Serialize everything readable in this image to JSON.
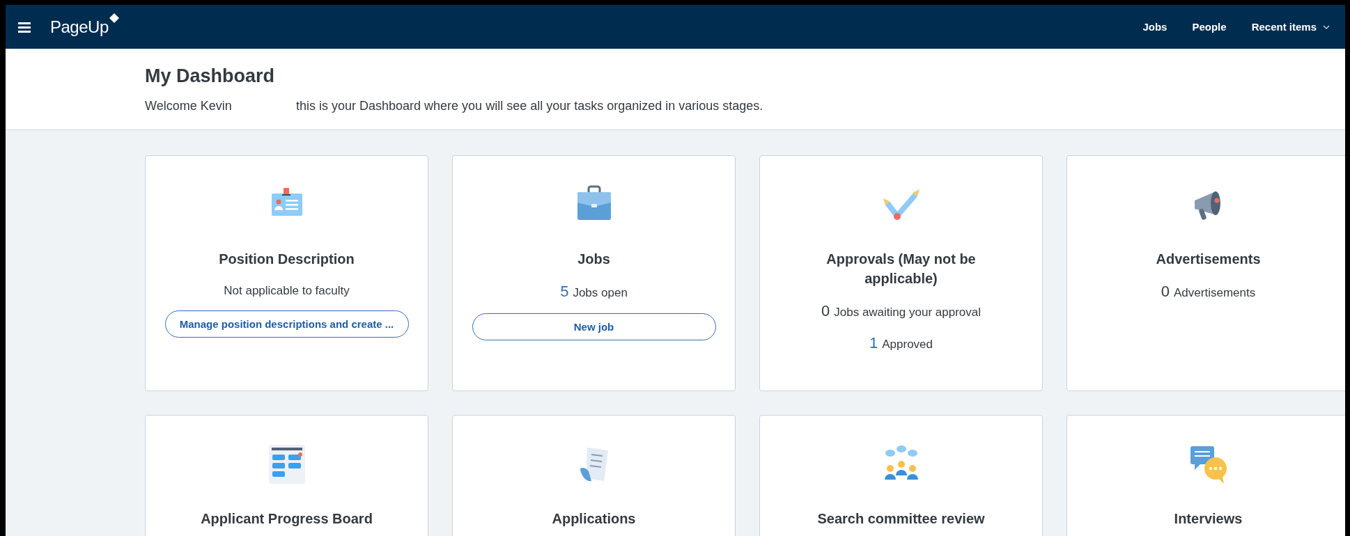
{
  "header": {
    "logo": "PageUp",
    "nav": [
      "Jobs",
      "People",
      "Recent items"
    ]
  },
  "page": {
    "title": "My Dashboard",
    "welcome": "Welcome Kevin",
    "subtitle": "this is your Dashboard where you will see all your tasks organized in various stages."
  },
  "cards": [
    {
      "title": "Position Description",
      "note": "Not applicable to faculty",
      "button": "Manage position descriptions and create ..."
    },
    {
      "title": "Jobs",
      "stats": [
        {
          "count": "5",
          "text": "Jobs open",
          "color": "#2f6fb5"
        }
      ],
      "button": "New job"
    },
    {
      "title": "Approvals (May not be applicable)",
      "stats": [
        {
          "count": "0",
          "text": "Jobs awaiting your approval",
          "color": "#333a40"
        },
        {
          "count": "1",
          "text": "Approved",
          "color": "#2f6fb5"
        }
      ]
    },
    {
      "title": "Advertisements",
      "stats": [
        {
          "count": "0",
          "text": "Advertisements",
          "color": "#333a40"
        }
      ]
    },
    {
      "title": "Applicant Progress Board"
    },
    {
      "title": "Applications"
    },
    {
      "title": "Search committee review"
    },
    {
      "title": "Interviews"
    }
  ]
}
